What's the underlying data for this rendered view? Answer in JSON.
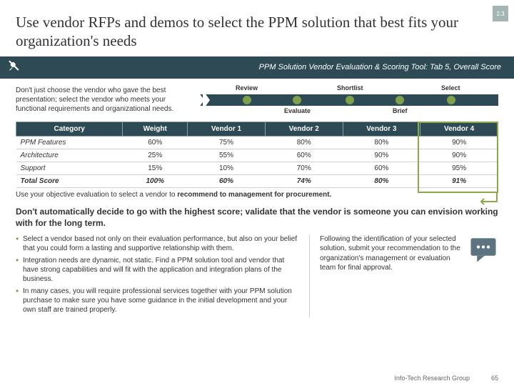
{
  "badge": "2.3",
  "title": "Use vendor RFPs and demos to select the PPM solution that best fits your organization's needs",
  "banner_text": "PPM Solution Vendor Evaluation & Scoring Tool: Tab 5, Overall Score",
  "intro": "Don't just choose the vendor who gave the best presentation; select the vendor who meets your functional requirements and organizational needs.",
  "process": {
    "top": [
      "Review",
      "Shortlist",
      "Select"
    ],
    "bottom": [
      "Evaluate",
      "Brief"
    ]
  },
  "table": {
    "headers": [
      "Category",
      "Weight",
      "Vendor 1",
      "Vendor 2",
      "Vendor 3",
      "Vendor 4"
    ],
    "rows": [
      [
        "PPM Features",
        "60%",
        "75%",
        "80%",
        "80%",
        "90%"
      ],
      [
        "Architecture",
        "25%",
        "55%",
        "60%",
        "90%",
        "90%"
      ],
      [
        "Support",
        "15%",
        "10%",
        "70%",
        "60%",
        "95%"
      ],
      [
        "Total Score",
        "100%",
        "60%",
        "74%",
        "80%",
        "91%"
      ]
    ]
  },
  "useobj_pre": "Use your objective evaluation to select a vendor to ",
  "useobj_bold": "recommend to management for procurement.",
  "dontauto": "Don't automatically decide to go with the highest score; validate that the vendor is someone you can envision working with for the long term.",
  "bullets": [
    "Select a vendor based not only on their evaluation performance, but also on your belief that you could form a lasting and supportive relationship with them.",
    "Integration needs are dynamic, not static. Find a PPM solution tool and vendor that have strong capabilities and will fit with the application and integration plans of the business.",
    "In many cases, you will require professional services together with your PPM solution purchase to make sure you have some guidance in the initial development and your own staff are trained properly."
  ],
  "side_text": "Following the identification of your selected solution, submit your recommendation to the organization's management or evaluation team for final approval.",
  "footer_org": "Info-Tech Research Group",
  "footer_page": "65"
}
